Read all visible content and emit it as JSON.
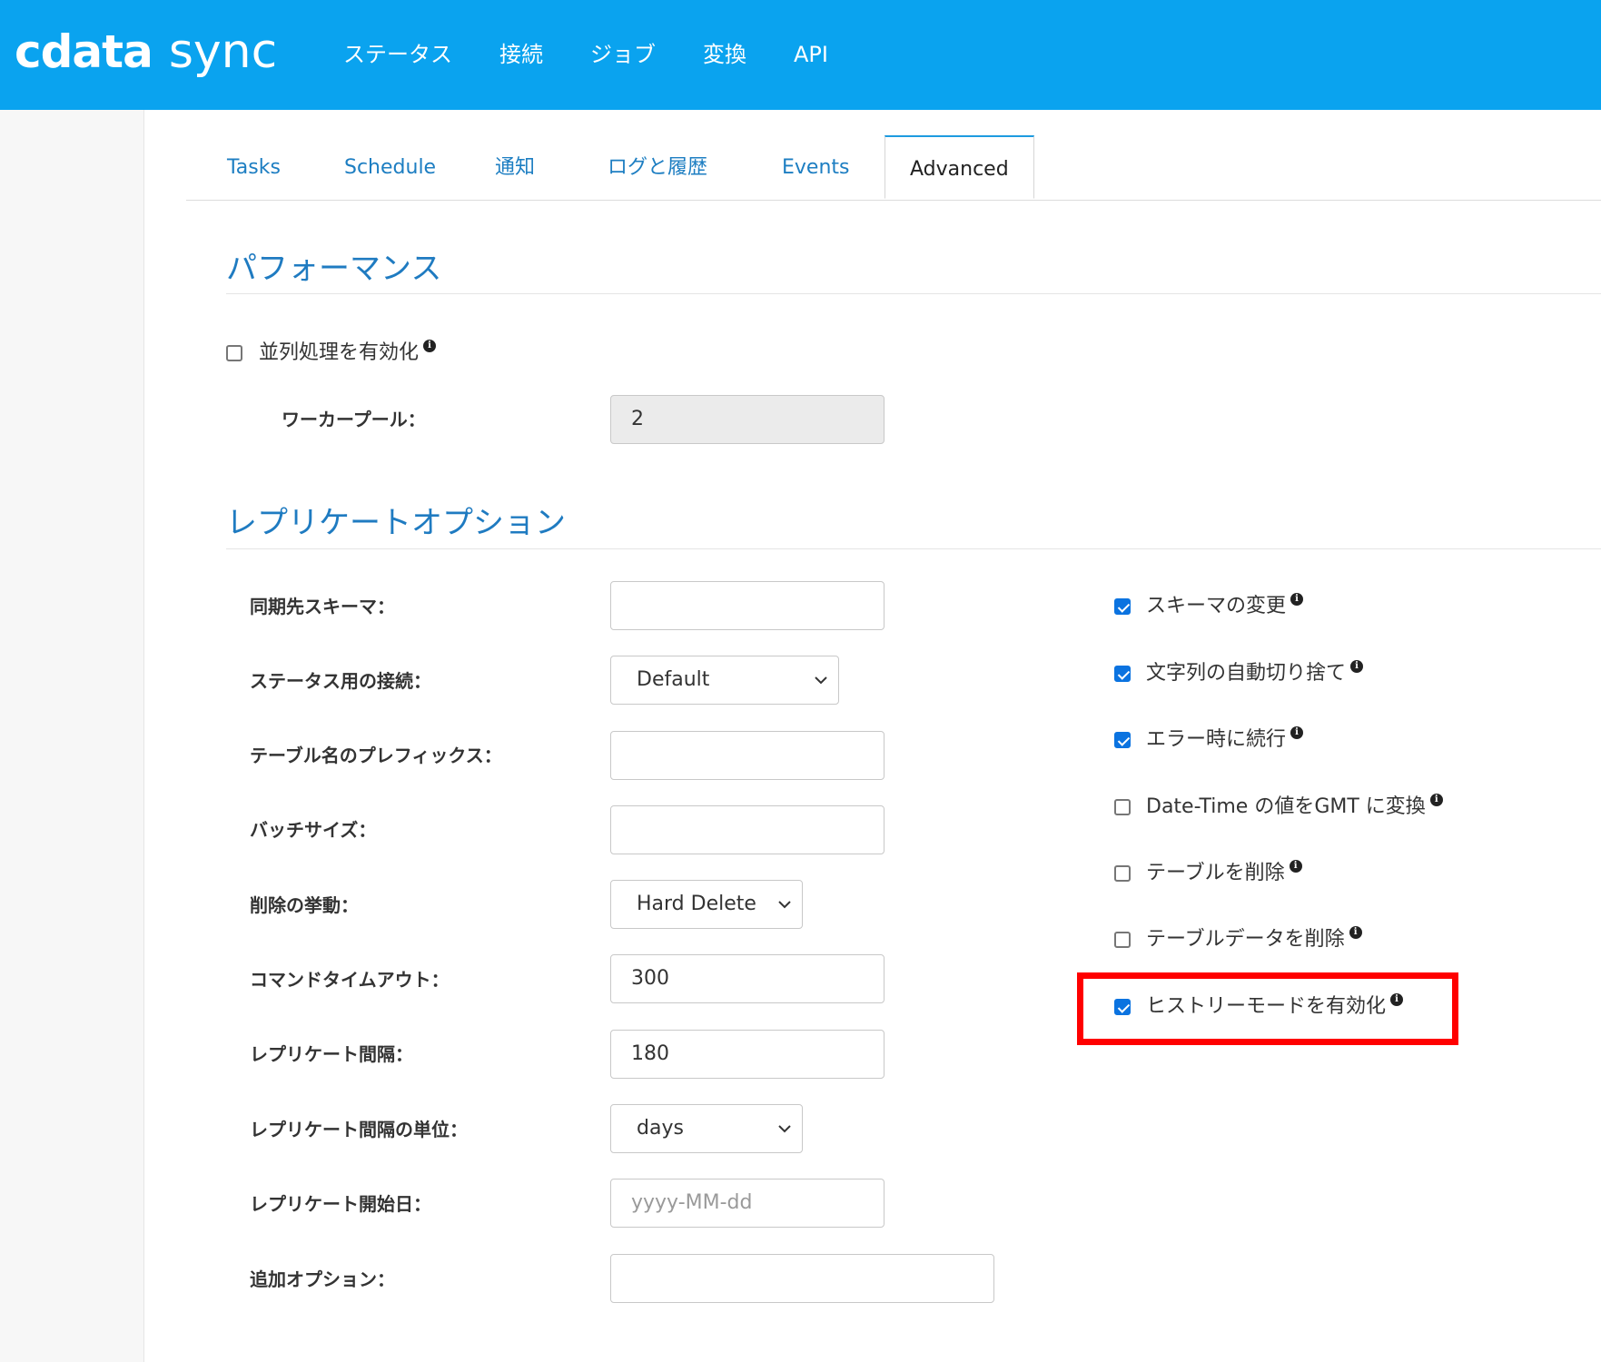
{
  "app": {
    "logo_mark": "cdata",
    "logo_word": "sync",
    "brand_color": "#0aa3ef",
    "nav": [
      "ステータス",
      "接続",
      "ジョブ",
      "変換",
      "API"
    ]
  },
  "tabs": [
    {
      "label": "Tasks",
      "active": false
    },
    {
      "label": "Schedule",
      "active": false
    },
    {
      "label": "通知",
      "active": false
    },
    {
      "label": "ログと履歴",
      "active": false
    },
    {
      "label": "Events",
      "active": false
    },
    {
      "label": "Advanced",
      "active": true
    }
  ],
  "performance": {
    "title": "パフォーマンス",
    "parallel_label": "並列処理を有効化",
    "parallel_checked": false,
    "worker_pool_label": "ワーカープール：",
    "worker_pool_value": "2"
  },
  "replicate": {
    "title": "レプリケートオプション",
    "fields": {
      "dest_schema": {
        "label": "同期先スキーマ：",
        "value": ""
      },
      "status_connection": {
        "label": "ステータス用の接続：",
        "value": "Default"
      },
      "table_prefix": {
        "label": "テーブル名のプレフィックス：",
        "value": ""
      },
      "batch_size": {
        "label": "バッチサイズ：",
        "value": ""
      },
      "delete_behavior": {
        "label": "削除の挙動：",
        "value": "Hard Delete"
      },
      "command_timeout": {
        "label": "コマンドタイムアウト：",
        "value": "300"
      },
      "replicate_interval": {
        "label": "レプリケート間隔：",
        "value": "180"
      },
      "interval_unit": {
        "label": "レプリケート間隔の単位：",
        "value": "days"
      },
      "start_date": {
        "label": "レプリケート開始日：",
        "placeholder": "yyyy-MM-dd"
      },
      "extra_options": {
        "label": "追加オプション：",
        "value": ""
      }
    },
    "options": [
      {
        "label": "スキーマの変更",
        "checked": true
      },
      {
        "label": "文字列の自動切り捨て",
        "checked": true
      },
      {
        "label": "エラー時に続行",
        "checked": true
      },
      {
        "label": "Date-Time の値をGMT に変換",
        "checked": false
      },
      {
        "label": "テーブルを削除",
        "checked": false
      },
      {
        "label": "テーブルデータを削除",
        "checked": false
      },
      {
        "label": "ヒストリーモードを有効化",
        "checked": true
      }
    ],
    "highlight_color": "#ff0000"
  }
}
